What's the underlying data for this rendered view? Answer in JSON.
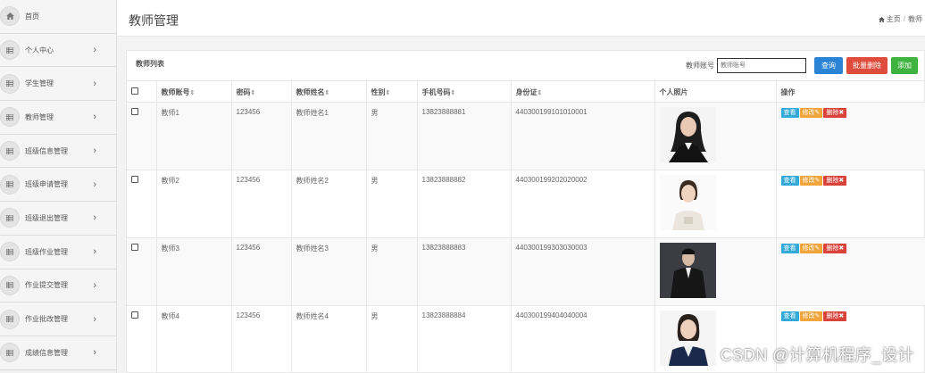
{
  "sidebar": {
    "items": [
      {
        "label": "首页",
        "icon": "home-icon"
      },
      {
        "label": "个人中心",
        "icon": "grid-icon"
      },
      {
        "label": "学生管理",
        "icon": "grid-icon"
      },
      {
        "label": "教师管理",
        "icon": "grid-icon"
      },
      {
        "label": "班级信息管理",
        "icon": "grid-icon"
      },
      {
        "label": "班级申请管理",
        "icon": "grid-icon"
      },
      {
        "label": "班级退出管理",
        "icon": "grid-icon"
      },
      {
        "label": "班级作业管理",
        "icon": "grid-icon"
      },
      {
        "label": "作业提交管理",
        "icon": "grid-icon"
      },
      {
        "label": "作业批改管理",
        "icon": "grid-icon"
      },
      {
        "label": "成绩信息管理",
        "icon": "grid-icon"
      }
    ]
  },
  "header": {
    "title": "教师管理",
    "breadcrumb_home": "主页",
    "breadcrumb_sep": "/",
    "breadcrumb_current": "教师"
  },
  "panel": {
    "title": "教师列表",
    "search_label": "教师账号",
    "search_placeholder": "教师账号",
    "search_button": "查询",
    "batch_delete_button": "批量删除",
    "add_button": "添加"
  },
  "table": {
    "columns": [
      "教师账号",
      "密码",
      "教师姓名",
      "性别",
      "手机号码",
      "身份证",
      "个人照片",
      "操作"
    ],
    "rows": [
      {
        "account": "教师1",
        "password": "123456",
        "name": "教师姓名1",
        "gender": "男",
        "phone": "13823888881",
        "id_card": "440300199101010001"
      },
      {
        "account": "教师2",
        "password": "123456",
        "name": "教师姓名2",
        "gender": "男",
        "phone": "13823888882",
        "id_card": "440300199202020002"
      },
      {
        "account": "教师3",
        "password": "123456",
        "name": "教师姓名3",
        "gender": "男",
        "phone": "13823888883",
        "id_card": "440300199303030003"
      },
      {
        "account": "教师4",
        "password": "123456",
        "name": "教师姓名4",
        "gender": "男",
        "phone": "13823888884",
        "id_card": "440300199404040004"
      }
    ],
    "op_view": "查看",
    "op_edit": "修改",
    "op_delete": "删除"
  },
  "watermark": "CSDN @计算机程序_设计",
  "colors": {
    "primary": "#2b83d6",
    "danger": "#e04c3b",
    "success": "#3fb33f",
    "info": "#33a9d8",
    "warning": "#f0a43a"
  }
}
